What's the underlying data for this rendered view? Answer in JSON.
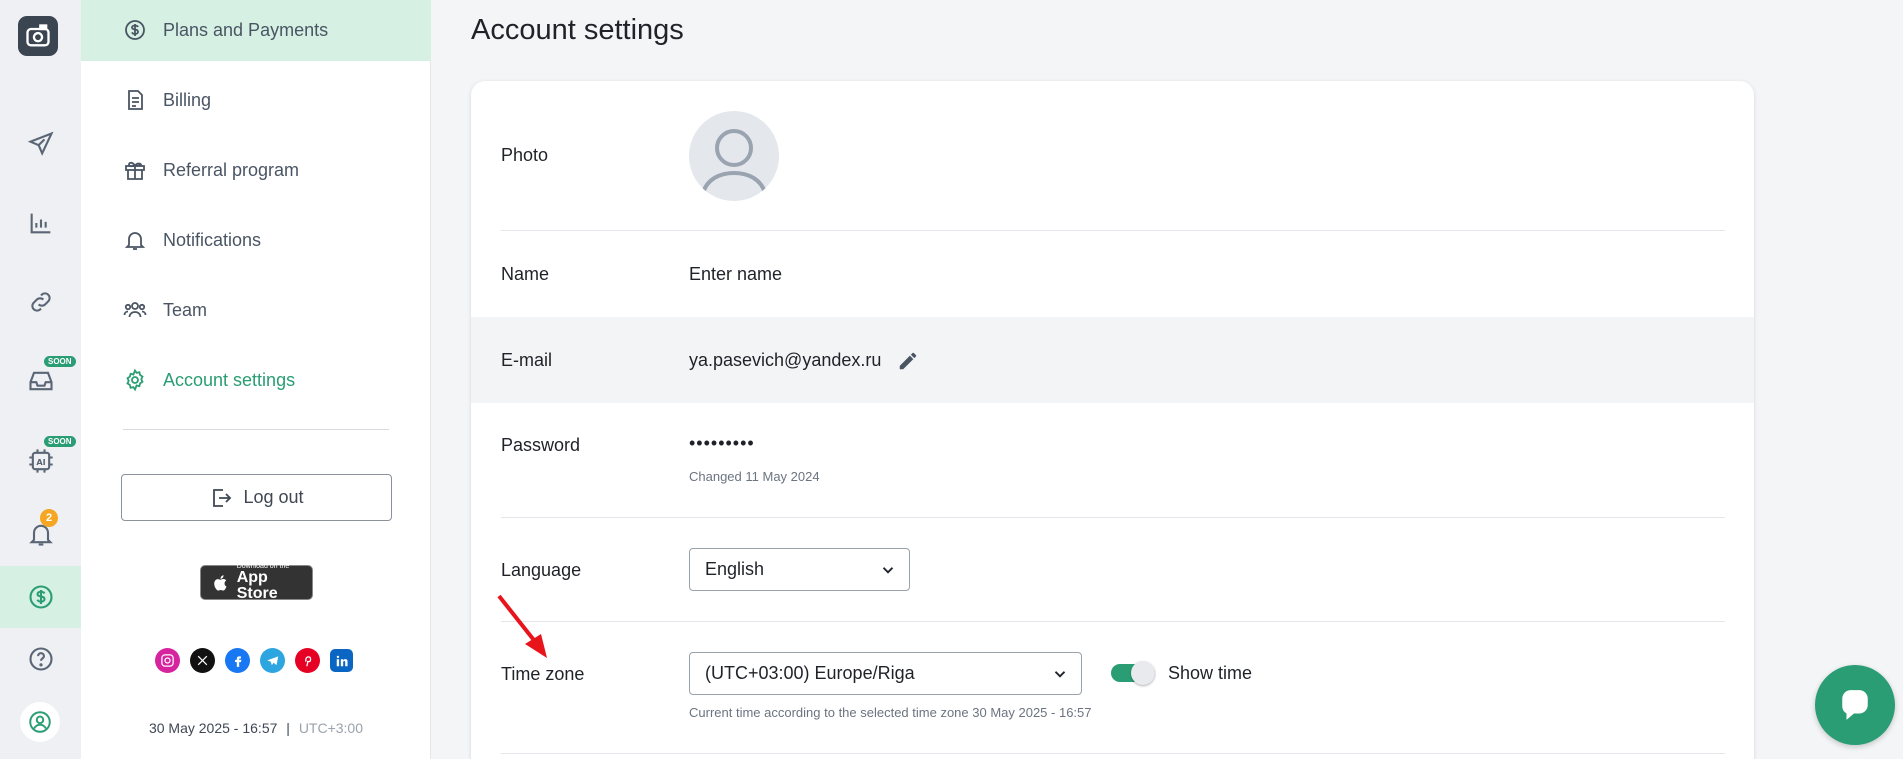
{
  "rail": {
    "soon_label": "SOON",
    "notification_count": "2"
  },
  "menu": {
    "items": [
      {
        "label": "Plans and Payments",
        "icon": "dollar-circle-icon"
      },
      {
        "label": "Billing",
        "icon": "document-icon"
      },
      {
        "label": "Referral program",
        "icon": "gift-icon"
      },
      {
        "label": "Notifications",
        "icon": "bell-icon"
      },
      {
        "label": "Team",
        "icon": "team-icon"
      },
      {
        "label": "Account settings",
        "icon": "gear-icon"
      }
    ],
    "logout_label": "Log out",
    "appstore_small": "Download on the",
    "appstore_big": "App Store",
    "footer_datetime": "30 May 2025 - 16:57",
    "footer_separator": "|",
    "footer_tz": "UTC+3:00"
  },
  "main": {
    "title": "Account settings",
    "photo_label": "Photo",
    "name_label": "Name",
    "name_value": "Enter name",
    "email_label": "E-mail",
    "email_value": "ya.pasevich@yandex.ru",
    "password_label": "Password",
    "password_value": "•••••••••",
    "password_changed": "Changed 11 May 2024",
    "language_label": "Language",
    "language_value": "English",
    "timezone_label": "Time zone",
    "timezone_value": "(UTC+03:00) Europe/Riga",
    "show_time_label": "Show time",
    "show_time_on": true,
    "timezone_hint": "Current time according to the selected time zone 30 May 2025 - 16:57"
  },
  "colors": {
    "accent": "#2a9d74",
    "badge": "#f5a623",
    "arrow": "#e8141b"
  }
}
